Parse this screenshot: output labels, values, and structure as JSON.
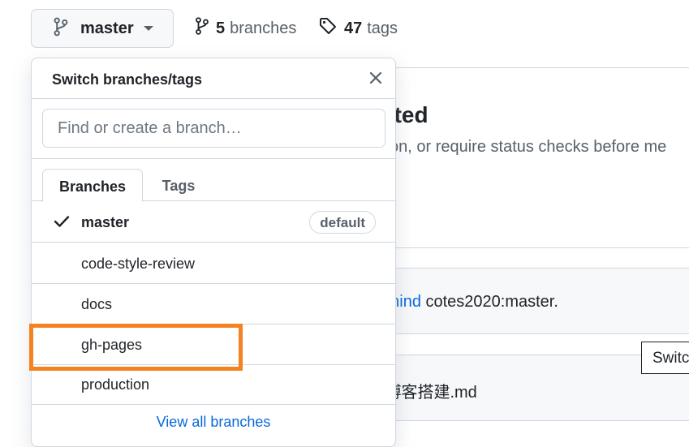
{
  "branch_button": {
    "label": "master"
  },
  "repo_meta": {
    "branches_count": "5",
    "branches_label": "branches",
    "tags_count": "47",
    "tags_label": "tags"
  },
  "background": {
    "heading": "cted",
    "subtext": "tion, or require status checks before me",
    "behind_link": "ehind",
    "behind_rest": " cotes2020:master.",
    "file_name": "l博客搭建.md",
    "tooltip": "Switc"
  },
  "dropdown": {
    "title": "Switch branches/tags",
    "search_placeholder": "Find or create a branch…",
    "tabs": [
      {
        "label": "Branches",
        "active": true
      },
      {
        "label": "Tags",
        "active": false
      }
    ],
    "items": [
      {
        "name": "master",
        "checked": true,
        "badge": "default"
      },
      {
        "name": "code-style-review"
      },
      {
        "name": "docs"
      },
      {
        "name": "gh-pages"
      },
      {
        "name": "production"
      }
    ],
    "view_all": "View all branches"
  },
  "colors": {
    "highlight": "#f58220",
    "link": "#0969da",
    "border": "#d0d7de"
  }
}
